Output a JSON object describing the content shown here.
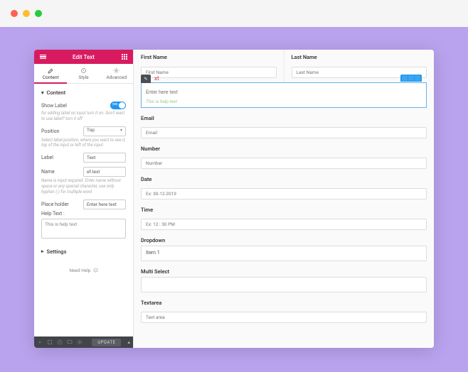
{
  "panel": {
    "title": "Edit Text",
    "tabs": {
      "content": "Content",
      "style": "Style",
      "advanced": "Advanced"
    },
    "section_content": "Content",
    "show_label": "Show Label",
    "show_label_toggle_text": "yes",
    "hint_show_label": "for adding label on input turn it on. Don't want to use label? turn it off",
    "position_label": "Position",
    "position_value": "Top",
    "hint_position": "Select label position, where you want to see it, top of the input or left of the input",
    "label_label": "Label",
    "label_value": "Text",
    "name_label": "Name",
    "name_value": "ef-text",
    "hint_name": "Name is input required. Enter name without space or any special character, use only hyphen (-) for multiple word",
    "placeholder_label": "Place holder",
    "placeholder_value": "Enter here text",
    "helptext_label": "Help Text :",
    "helptext_value": "This is help text",
    "section_settings": "Settings",
    "need_help": "Need Help",
    "update_btn": "UPDATE"
  },
  "form": {
    "first_name": {
      "label": "First Name",
      "placeholder": "First Name"
    },
    "last_name": {
      "label": "Last Name",
      "placeholder": "Last Name"
    },
    "selected": {
      "tag": "xt",
      "placeholder": "Enter here text",
      "helptext": "This is help text"
    },
    "email": {
      "label": "Email",
      "placeholder": "Email"
    },
    "number": {
      "label": "Number",
      "placeholder": "Number"
    },
    "date": {
      "label": "Date",
      "placeholder": "Ex: 30-12-2019"
    },
    "time": {
      "label": "Time",
      "placeholder": "Ex: 12 : 30 PM"
    },
    "dropdown": {
      "label": "Dropdown",
      "value": "Item 1"
    },
    "multiselect": {
      "label": "Multi Select"
    },
    "textarea": {
      "label": "Textarea",
      "placeholder": "Text area"
    }
  }
}
